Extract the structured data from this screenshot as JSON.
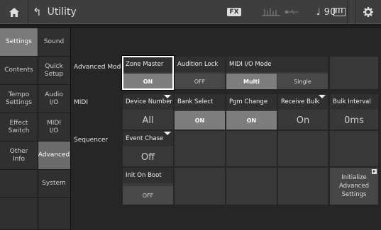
{
  "header": {
    "title": "Utility",
    "fx_badge": "FX",
    "tempo_symbol": "♩",
    "tempo_value": "90"
  },
  "nav1": [
    {
      "label": "Settings",
      "active": true
    },
    {
      "label": "Contents",
      "active": false
    },
    {
      "label": "Tempo\nSettings",
      "active": false
    },
    {
      "label": "Effect\nSwitch",
      "active": false
    },
    {
      "label": "Other\nInfo",
      "active": false
    },
    {
      "label": "",
      "active": false
    },
    {
      "label": "",
      "active": false
    }
  ],
  "nav2": [
    {
      "label": "Sound",
      "active": false
    },
    {
      "label": "Quick\nSetup",
      "active": false
    },
    {
      "label": "Audio\nI/O",
      "active": false
    },
    {
      "label": "MIDI\nI/O",
      "active": false
    },
    {
      "label": "Advanced",
      "active": true
    },
    {
      "label": "System",
      "active": false
    },
    {
      "label": "",
      "active": false
    }
  ],
  "rows": {
    "advanced_mode": "Advanced Mode",
    "midi": "MIDI",
    "sequencer": "Sequencer"
  },
  "cells": {
    "zone_master": {
      "label": "Zone Master",
      "value": "ON"
    },
    "audition_lock": {
      "label": "Audition Lock",
      "value": "OFF"
    },
    "midi_io_mode": {
      "label": "MIDI I/O Mode",
      "multi": "Multi",
      "single": "Single"
    },
    "device_number": {
      "label": "Device Number",
      "value": "All"
    },
    "bank_select": {
      "label": "Bank Select",
      "value": "ON"
    },
    "pgm_change": {
      "label": "Pgm Change",
      "value": "ON"
    },
    "receive_bulk": {
      "label": "Receive Bulk",
      "value": "On"
    },
    "bulk_interval": {
      "label": "Bulk Interval",
      "value": "0ms"
    },
    "event_chase": {
      "label": "Event Chase",
      "value": "Off"
    },
    "init_on_boot": {
      "label": "Init On Boot",
      "value": "OFF"
    },
    "initialize_advanced": {
      "label": "Initialize\nAdvanced\nSettings"
    }
  }
}
